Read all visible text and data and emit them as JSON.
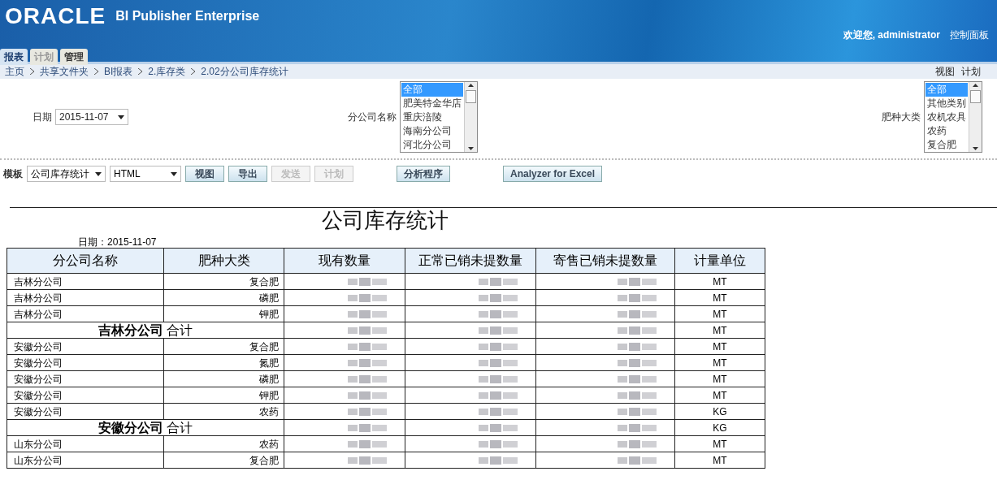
{
  "header": {
    "logo": "ORACLE",
    "product": "BI Publisher Enterprise",
    "welcome": "欢迎您, administrator",
    "control_panel": "控制面板"
  },
  "tabs": [
    {
      "label": "报表",
      "selected": true
    },
    {
      "label": "计划",
      "selected": false
    },
    {
      "label": "管理",
      "selected": false
    }
  ],
  "breadcrumb": [
    "主页",
    "共享文件夹",
    "BI报表",
    "2.库存类",
    "2.02分公司库存统计"
  ],
  "right_links": [
    "视图",
    "计划"
  ],
  "params": {
    "date": {
      "label": "日期",
      "value": "2015-11-07"
    },
    "branch": {
      "label": "分公司名称",
      "options": [
        {
          "label": "全部",
          "selected": true
        },
        {
          "label": "肥美特金华店",
          "selected": false
        },
        {
          "label": "重庆涪陵",
          "selected": false
        },
        {
          "label": "海南分公司",
          "selected": false
        },
        {
          "label": "河北分公司",
          "selected": false
        }
      ]
    },
    "category": {
      "label": "肥种大类",
      "options": [
        {
          "label": "全部",
          "selected": true
        },
        {
          "label": "其他类别",
          "selected": false
        },
        {
          "label": "农机农具",
          "selected": false
        },
        {
          "label": "农药",
          "selected": false
        },
        {
          "label": "复合肥",
          "selected": false
        }
      ]
    }
  },
  "toolbar": {
    "template_label": "模板",
    "template": "公司库存统计",
    "format": "HTML",
    "buttons": [
      {
        "label": "视图",
        "disabled": false
      },
      {
        "label": "导出",
        "disabled": false
      },
      {
        "label": "发送",
        "disabled": true
      },
      {
        "label": "计划",
        "disabled": true
      },
      {
        "label": "分析程序",
        "disabled": false
      },
      {
        "label": "Analyzer for Excel",
        "disabled": false
      }
    ]
  },
  "report": {
    "title": "公司库存统计",
    "date_line": "日期：2015-11-07",
    "columns": [
      "分公司名称",
      "肥种大类",
      "现有数量",
      "正常已销未提数量",
      "寄售已销未提数量",
      "计量单位"
    ],
    "rows": [
      {
        "kind": "detail",
        "branch": "吉林分公司",
        "category": "复合肥",
        "unit": "MT"
      },
      {
        "kind": "detail",
        "branch": "吉林分公司",
        "category": "磷肥",
        "unit": "MT"
      },
      {
        "kind": "detail",
        "branch": "吉林分公司",
        "category": "钾肥",
        "unit": "MT"
      },
      {
        "kind": "subtotal",
        "branch": "**吉林分公司** 合计",
        "unit": "MT"
      },
      {
        "kind": "detail",
        "branch": "安徽分公司",
        "category": "复合肥",
        "unit": "MT"
      },
      {
        "kind": "detail",
        "branch": "安徽分公司",
        "category": "氮肥",
        "unit": "MT"
      },
      {
        "kind": "detail",
        "branch": "安徽分公司",
        "category": "磷肥",
        "unit": "MT"
      },
      {
        "kind": "detail",
        "branch": "安徽分公司",
        "category": "钾肥",
        "unit": "MT"
      },
      {
        "kind": "detail",
        "branch": "安徽分公司",
        "category": "农药",
        "unit": "KG"
      },
      {
        "kind": "subtotal",
        "branch": "**安徽分公司** 合计",
        "unit": "KG"
      },
      {
        "kind": "detail",
        "branch": "山东分公司",
        "category": "农药",
        "unit": "MT"
      },
      {
        "kind": "detail",
        "branch": "山东分公司",
        "category": "复合肥",
        "unit": "MT"
      }
    ]
  }
}
